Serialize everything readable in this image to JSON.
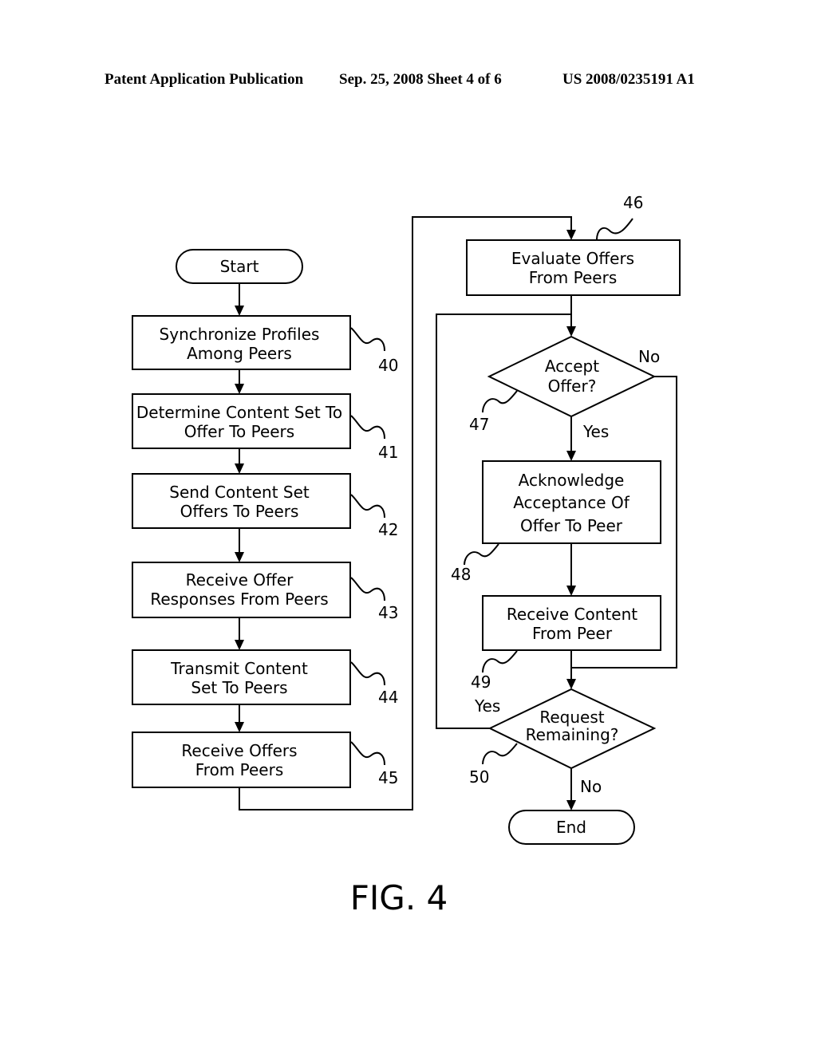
{
  "header": {
    "publication": "Patent Application Publication",
    "date_sheet": "Sep. 25, 2008   Sheet 4 of 6",
    "number": "US 2008/0235191 A1"
  },
  "figure_label": "FIG. 4",
  "nodes": {
    "start": {
      "lines": [
        "Start"
      ]
    },
    "n40": {
      "lines": [
        "Synchronize Profiles",
        "Among Peers"
      ],
      "ref": "40"
    },
    "n41": {
      "lines": [
        "Determine Content Set To",
        "Offer To Peers"
      ],
      "ref": "41"
    },
    "n42": {
      "lines": [
        "Send Content Set",
        "Offers To Peers"
      ],
      "ref": "42"
    },
    "n43": {
      "lines": [
        "Receive Offer",
        "Responses From Peers"
      ],
      "ref": "43"
    },
    "n44": {
      "lines": [
        "Transmit Content",
        "Set To Peers"
      ],
      "ref": "44"
    },
    "n45": {
      "lines": [
        "Receive Offers",
        "From Peers"
      ],
      "ref": "45"
    },
    "n46": {
      "lines": [
        "Evaluate Offers",
        "From Peers"
      ],
      "ref": "46"
    },
    "n47": {
      "lines": [
        "Accept",
        "Offer?"
      ],
      "ref": "47"
    },
    "n48": {
      "lines": [
        "Acknowledge",
        "Acceptance Of",
        "Offer To Peer"
      ],
      "ref": "48"
    },
    "n49": {
      "lines": [
        "Receive Content",
        "From Peer"
      ],
      "ref": "49"
    },
    "n50": {
      "lines": [
        "Request",
        "Remaining?"
      ],
      "ref": "50"
    },
    "end": {
      "lines": [
        "End"
      ]
    }
  },
  "edge_labels": {
    "accept_no": "No",
    "accept_yes": "Yes",
    "remaining_yes": "Yes",
    "remaining_no": "No"
  }
}
